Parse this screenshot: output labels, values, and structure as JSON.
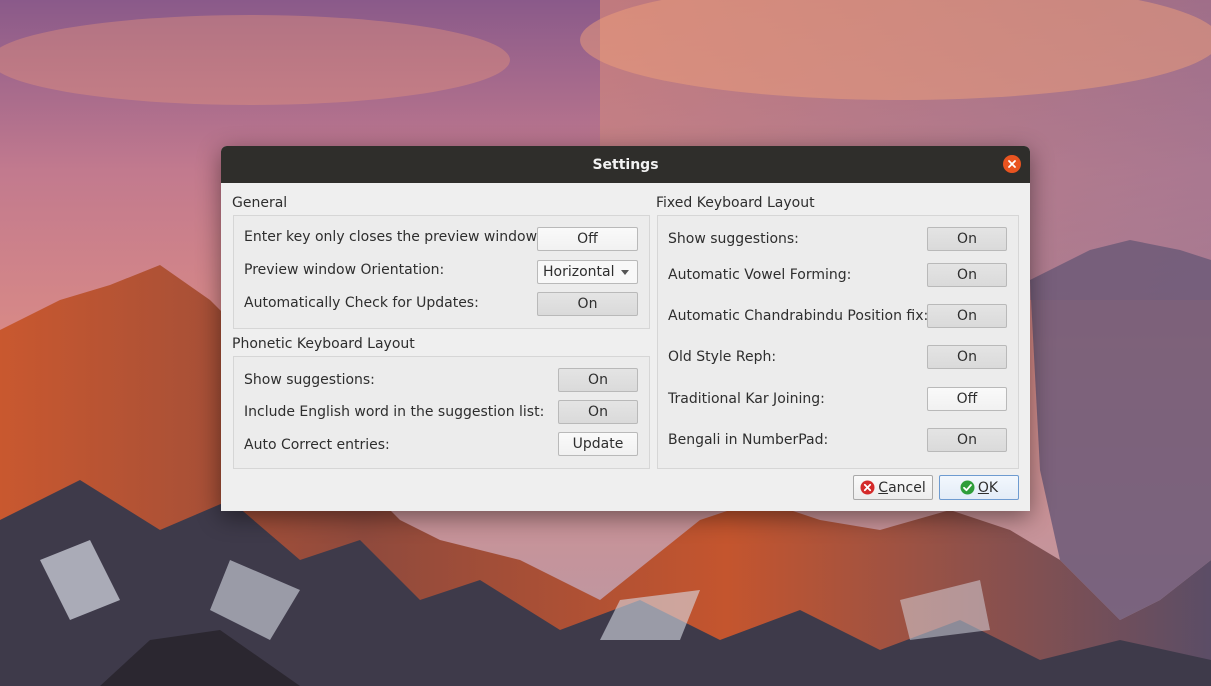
{
  "window": {
    "title": "Settings"
  },
  "general": {
    "title": "General",
    "enter_key_label": "Enter key only closes the preview window:",
    "enter_key_value": "Off",
    "orientation_label": "Preview window Orientation:",
    "orientation_value": "Horizontal",
    "updates_label": "Automatically Check for Updates:",
    "updates_value": "On"
  },
  "phonetic": {
    "title": "Phonetic Keyboard Layout",
    "suggestions_label": "Show suggestions:",
    "suggestions_value": "On",
    "english_label": "Include English word in the suggestion list:",
    "english_value": "On",
    "autocorrect_label": "Auto Correct entries:",
    "autocorrect_value": "Update"
  },
  "fixed": {
    "title": "Fixed Keyboard Layout",
    "rows": [
      {
        "label": "Show suggestions:",
        "value": "On"
      },
      {
        "label": "Automatic Vowel Forming:",
        "value": "On"
      },
      {
        "label": "Automatic Chandrabindu Position fix:",
        "value": "On"
      },
      {
        "label": "Old Style Reph:",
        "value": "On"
      },
      {
        "label": "Traditional Kar Joining:",
        "value": "Off"
      },
      {
        "label": "Bengali in NumberPad:",
        "value": "On"
      }
    ]
  },
  "buttons": {
    "cancel_first": "C",
    "cancel_rest": "ancel",
    "ok_first": "O",
    "ok_rest": "K"
  },
  "colors": {
    "titlebar": "#2f2e2b",
    "close": "#e95420",
    "cancel_icon": "#d42a2a",
    "ok_icon": "#2f9e3a"
  }
}
